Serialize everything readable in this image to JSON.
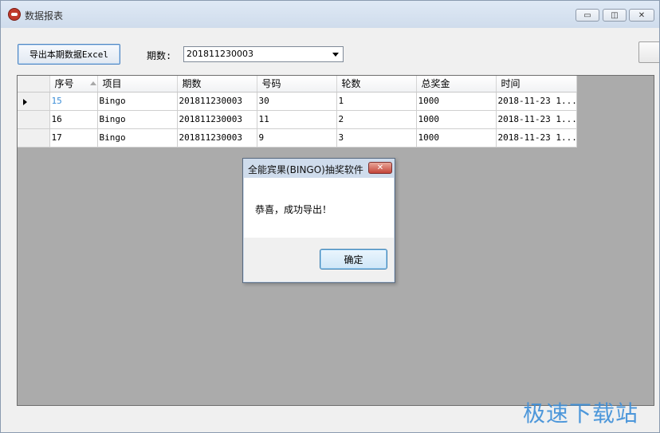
{
  "window": {
    "title": "数据报表",
    "controls": {
      "minimize": "▭",
      "maximize": "◫",
      "close": "✕"
    }
  },
  "toolbar": {
    "export_label": "导出本期数据Excel",
    "period_label": "期数:",
    "period_value": "201811230003"
  },
  "grid": {
    "columns": [
      "序号",
      "项目",
      "期数",
      "号码",
      "轮数",
      "总奖金",
      "时间"
    ],
    "sort_column": "序号",
    "rows": [
      [
        "15",
        "Bingo",
        "201811230003",
        "30",
        "1",
        "1000",
        "2018-11-23 1..."
      ],
      [
        "16",
        "Bingo",
        "201811230003",
        "11",
        "2",
        "1000",
        "2018-11-23 1..."
      ],
      [
        "17",
        "Bingo",
        "201811230003",
        "9",
        "3",
        "1000",
        "2018-11-23 1..."
      ]
    ]
  },
  "dialog": {
    "title": "全能宾果(BINGO)抽奖软件",
    "message": "恭喜，成功导出！",
    "ok_label": "确定",
    "close_symbol": "✕"
  },
  "watermark": "极速下载站",
  "colors": {
    "selected_text": "#3c8ed8",
    "grid_background": "#ababab",
    "dialog_frame": "#cfdcec"
  }
}
